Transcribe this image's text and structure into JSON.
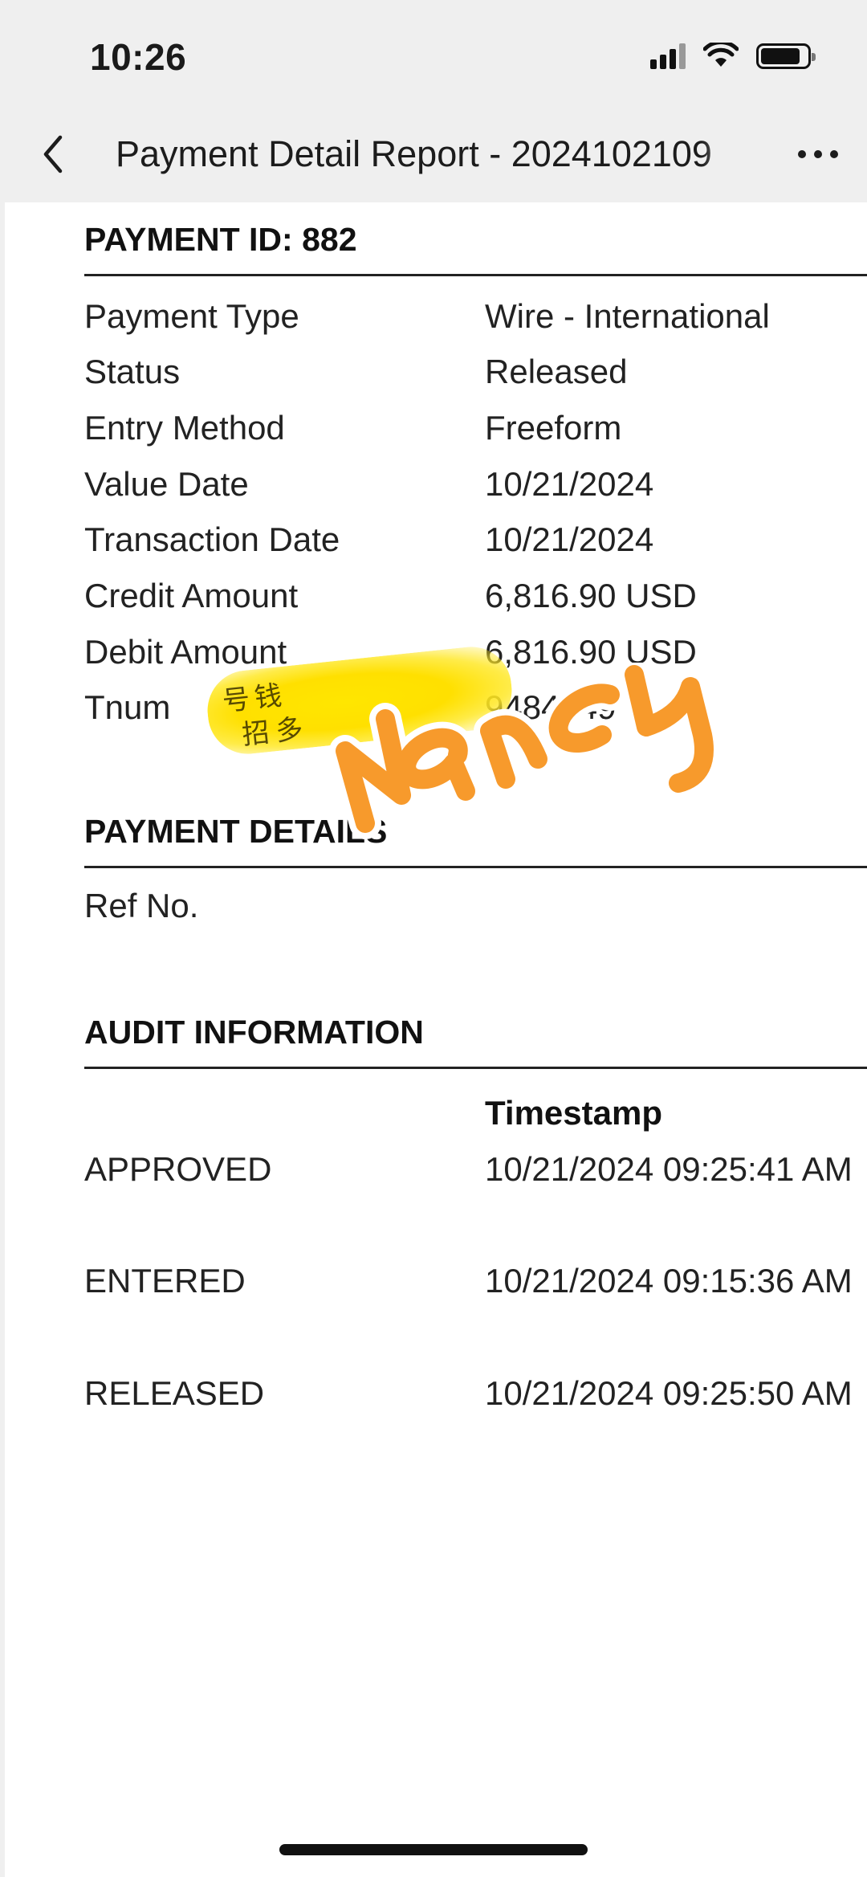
{
  "status_bar": {
    "time": "10:26"
  },
  "nav": {
    "title": "Payment Detail Report - 2024102109",
    "back_icon": "chevron-left-icon",
    "more_icon": "ellipsis-icon"
  },
  "payment": {
    "heading": "PAYMENT ID: 882",
    "fields": [
      {
        "label": "Payment Type",
        "value": "Wire - International"
      },
      {
        "label": "Status",
        "value": "Released"
      },
      {
        "label": "Entry Method",
        "value": "Freeform"
      },
      {
        "label": "Value Date",
        "value": "10/21/2024"
      },
      {
        "label": "Transaction Date",
        "value": "10/21/2024"
      },
      {
        "label": "Credit Amount",
        "value": "6,816.90 USD"
      },
      {
        "label": "Debit Amount",
        "value": "6,816.90 USD"
      },
      {
        "label": "Tnum",
        "value": "9484149"
      }
    ]
  },
  "payment_details": {
    "heading": "PAYMENT DETAILS",
    "ref_label": "Ref No.",
    "scribble_text_1": "号钱",
    "scribble_text_2": "招多",
    "overlay_signature": "Nancy"
  },
  "audit": {
    "heading": "AUDIT INFORMATION",
    "column_header": "Timestamp",
    "rows": [
      {
        "action": "APPROVED",
        "timestamp": "10/21/2024 09:25:41 AM"
      },
      {
        "action": "ENTERED",
        "timestamp": "10/21/2024 09:15:36 AM"
      },
      {
        "action": "RELEASED",
        "timestamp": "10/21/2024 09:25:50 AM"
      }
    ]
  },
  "colors": {
    "signature": "#f79a2c",
    "highlighter": "#ffe600",
    "page_background": "#efefef",
    "document_background": "#ffffff"
  }
}
